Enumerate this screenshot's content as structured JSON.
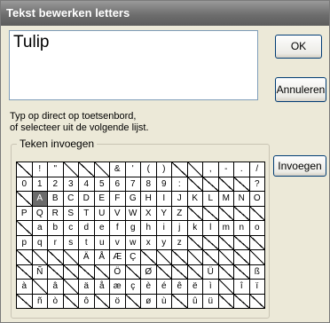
{
  "dialog": {
    "title": "Tekst bewerken letters",
    "text_value": "Tulip",
    "ok_label": "OK",
    "cancel_label": "Annuleren",
    "hint_line1": "Typ op direct op toetsenbord,",
    "hint_line2": "of selecteer uit de volgende lijst.",
    "group_label": "Teken invoegen",
    "insert_label": "Invoegen"
  },
  "grid": {
    "selected_char": "A",
    "rows": [
      [
        "",
        "!",
        "\"",
        "",
        "",
        "",
        "&",
        "'",
        "(",
        ")",
        "",
        "",
        ",",
        "-",
        ".",
        "/"
      ],
      [
        "0",
        "1",
        "2",
        "3",
        "4",
        "5",
        "6",
        "7",
        "8",
        "9",
        ":",
        "",
        "",
        "",
        "",
        "?"
      ],
      [
        "",
        "A",
        "B",
        "C",
        "D",
        "E",
        "F",
        "G",
        "H",
        "I",
        "J",
        "K",
        "L",
        "M",
        "N",
        "O"
      ],
      [
        "P",
        "Q",
        "R",
        "S",
        "T",
        "U",
        "V",
        "W",
        "X",
        "Y",
        "Z",
        "",
        "",
        "",
        "",
        ""
      ],
      [
        "",
        "a",
        "b",
        "c",
        "d",
        "e",
        "f",
        "g",
        "h",
        "i",
        "j",
        "k",
        "l",
        "m",
        "n",
        "o"
      ],
      [
        "p",
        "q",
        "r",
        "s",
        "t",
        "u",
        "v",
        "w",
        "x",
        "y",
        "z",
        "",
        "",
        "",
        "",
        ""
      ],
      [
        "",
        "",
        "",
        "",
        "Ä",
        "Å",
        "Æ",
        "Ç",
        "",
        "",
        "",
        "",
        "",
        "",
        "",
        ""
      ],
      [
        "",
        "Ñ",
        "",
        "",
        "",
        "",
        "Ö",
        "",
        "Ø",
        "",
        "",
        "",
        "Ü",
        "",
        "",
        "ß"
      ],
      [
        "à",
        "",
        "â",
        "",
        "ä",
        "å",
        "æ",
        "ç",
        "è",
        "é",
        "ê",
        "ë",
        "ì",
        "",
        "î",
        "ï"
      ],
      [
        "",
        "ñ",
        "ò",
        "",
        "ô",
        "",
        "ö",
        "",
        "ø",
        "ù",
        "",
        "û",
        "ü",
        "",
        "",
        ""
      ]
    ]
  }
}
